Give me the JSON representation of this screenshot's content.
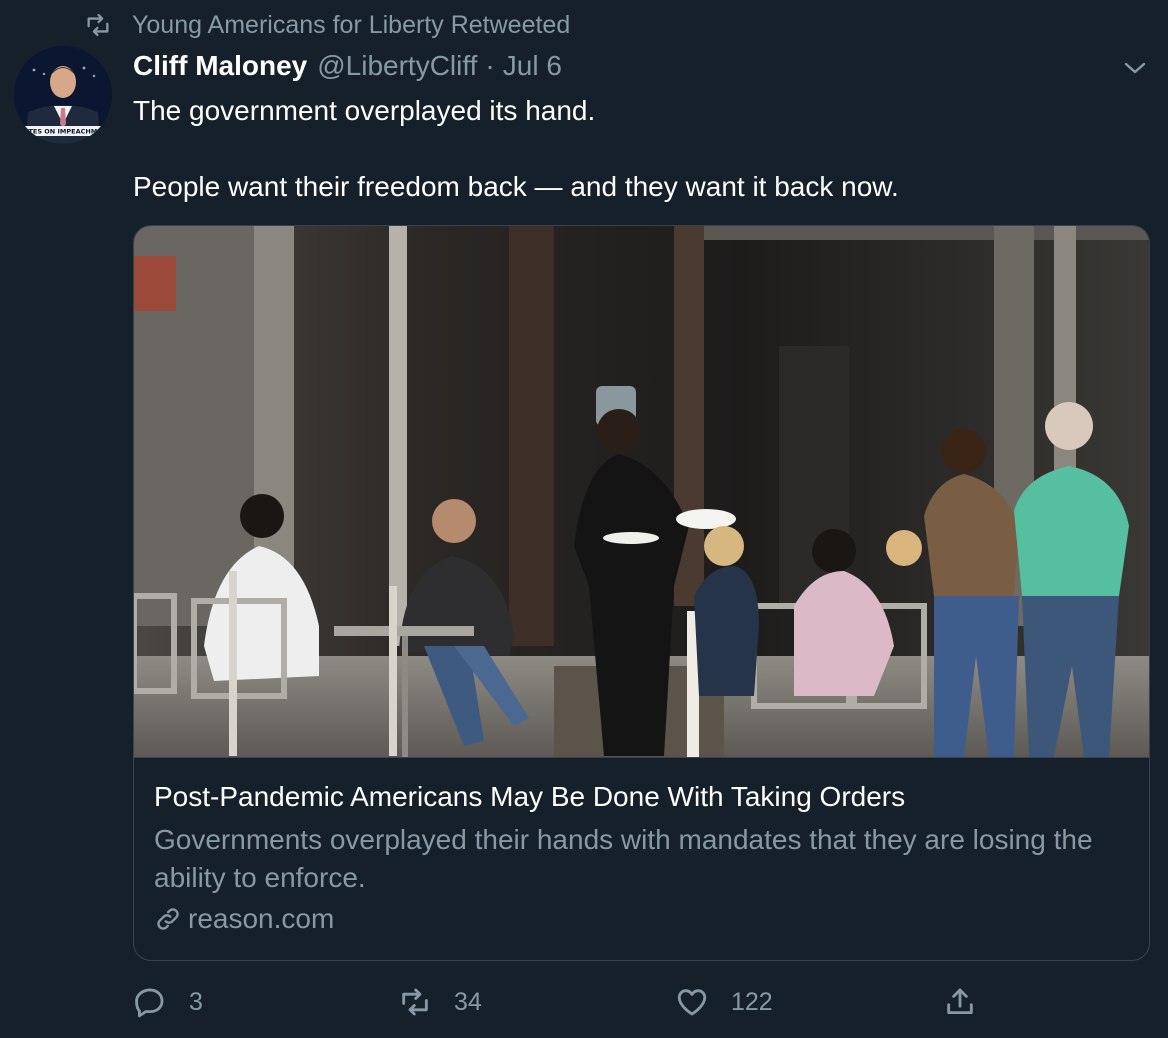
{
  "retweet_banner": {
    "text": "Young Americans for Liberty Retweeted"
  },
  "author": {
    "name": "Cliff Maloney",
    "handle": "@LibertyCliff",
    "separator": "·",
    "date": "Jul 6",
    "avatar_caption": "VOTES ON IMPEACHMENT AR"
  },
  "tweet": {
    "lines": [
      "The government overplayed its hand.",
      "People want their freedom back — and they want it back now."
    ]
  },
  "card": {
    "image_alt": "Photo of diners at an outdoor restaurant patio with a waiter wearing a face shield carrying plates, and masked pedestrians walking past",
    "title": "Post-Pandemic Americans May Be Done With Taking Orders",
    "description": "Governments overplayed their hands with mandates that they are losing the ability to enforce.",
    "domain": "reason.com"
  },
  "actions": {
    "replies": "3",
    "retweets": "34",
    "likes": "122"
  },
  "colors": {
    "background": "#15202b",
    "secondary_text": "#8899a6",
    "border": "#38444d"
  },
  "icons": [
    "retweet-icon",
    "chevron-down-icon",
    "link-icon",
    "reply-icon",
    "like-icon",
    "share-icon"
  ]
}
